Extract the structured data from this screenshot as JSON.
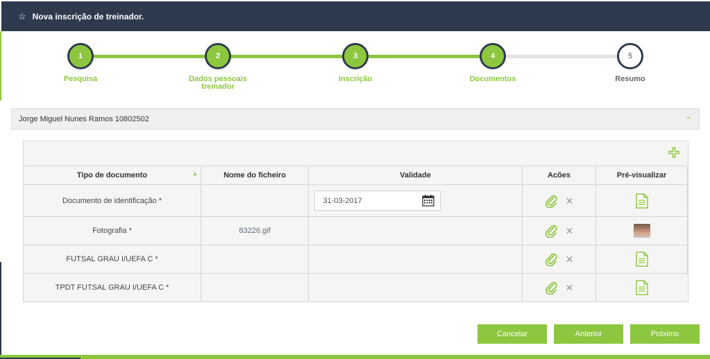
{
  "header": {
    "star_icon": "star-icon",
    "title": "Nova inscrição de treinador."
  },
  "stepper": {
    "steps": [
      {
        "number": "1",
        "label": "Pesquisa",
        "state": "done"
      },
      {
        "number": "2",
        "label": "Dados pessoais treinador",
        "state": "done"
      },
      {
        "number": "3",
        "label": "Inscrição",
        "state": "done"
      },
      {
        "number": "4",
        "label": "Documentos",
        "state": "current"
      },
      {
        "number": "5",
        "label": "Resumo",
        "state": "pending"
      }
    ]
  },
  "person": {
    "name": "Jorge Miguel Nunes Ramos 10802502",
    "collapse_icon": "chevron-up-icon"
  },
  "table": {
    "add_icon": "plus-icon",
    "headers": [
      "Tipo de documento",
      "Nome do ficheiro",
      "Validade",
      "Acões",
      "Pré-visualizar"
    ],
    "rows": [
      {
        "tipo": "Documento de identificação *",
        "ficheiro": "",
        "validade": "31-03-2017",
        "preview": "document-icon"
      },
      {
        "tipo": "Fotografia *",
        "ficheiro": "83226.gif",
        "validade": "",
        "preview": "photo-thumbnail"
      },
      {
        "tipo": "FUTSAL GRAU I/UEFA C *",
        "ficheiro": "",
        "validade": "",
        "preview": "document-icon"
      },
      {
        "tipo": "TPDT FUTSAL GRAU I/UEFA C *",
        "ficheiro": "",
        "validade": "",
        "preview": "document-icon"
      }
    ]
  },
  "buttons": {
    "cancel": "Cancelar",
    "previous": "Anterior",
    "next": "Próximo"
  },
  "colors": {
    "accent": "#8dc63f",
    "header": "#2e3b4e"
  }
}
